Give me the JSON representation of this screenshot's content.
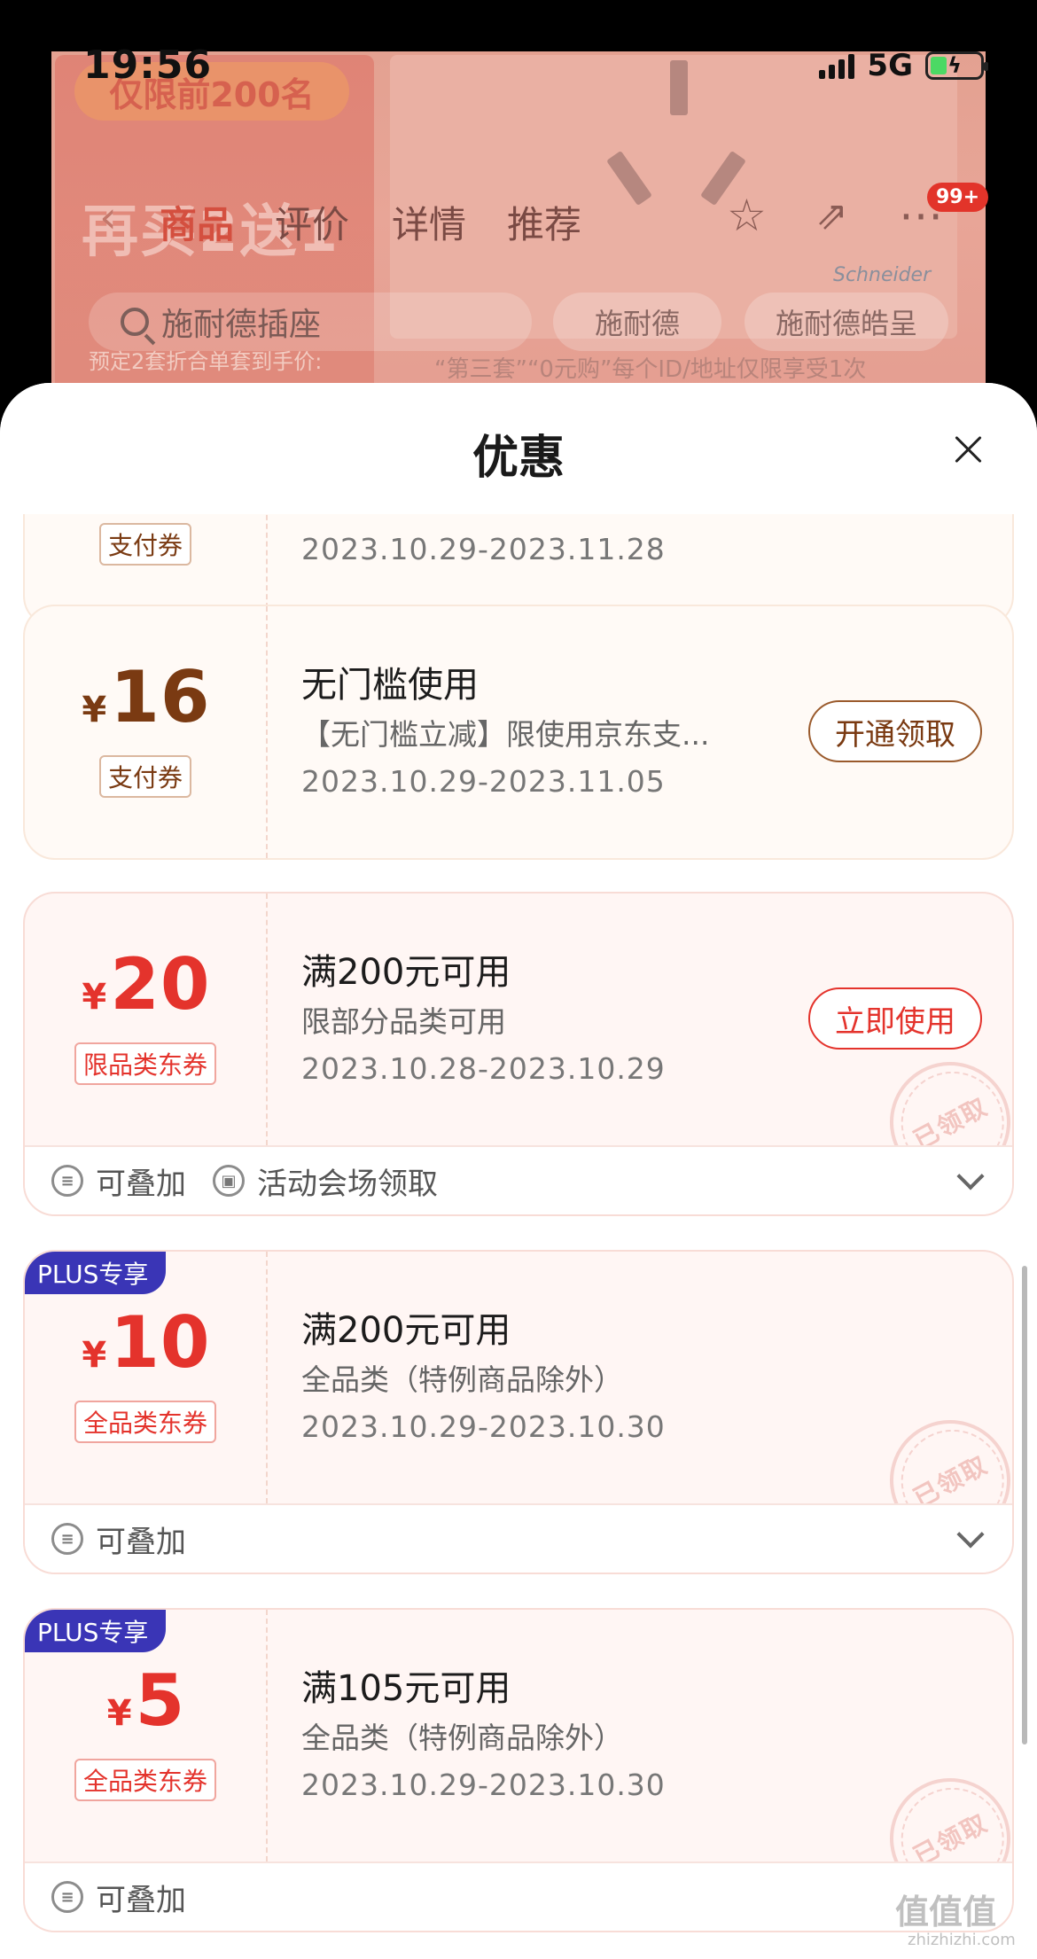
{
  "status_bar": {
    "time": "19:56",
    "network": "5G"
  },
  "background_page": {
    "promo_tag": "仅限前200名",
    "promo_headline": "再买2送1",
    "promo_sub": "预定2套折合单套到手价:",
    "nav_tabs": [
      "商品",
      "评价",
      "详情",
      "推荐"
    ],
    "active_tab": "商品",
    "badge": "99+",
    "search_placeholder": "施耐德插座",
    "chips": [
      "施耐德",
      "施耐德皓呈"
    ],
    "note": "“第三套”“0元购”每个ID/地址仅限享受1次",
    "brand": "Schneider"
  },
  "sheet": {
    "title": "优惠",
    "coupons": [
      {
        "style": "warm",
        "amount": "16",
        "currency": "¥",
        "type": "支付券",
        "title": "无门槛使用",
        "desc": "【无门槛立减】限使用京东支...",
        "date": "2023.10.29-2023.11.05",
        "button": "开通领取"
      },
      {
        "style": "red",
        "amount": "20",
        "currency": "¥",
        "type": "限品类东券",
        "title": "满200元可用",
        "desc": "限部分品类可用",
        "date": "2023.10.28-2023.10.29",
        "button": "立即使用",
        "stamp": "已领取",
        "footer": [
          "可叠加",
          "活动会场领取"
        ]
      },
      {
        "style": "red",
        "badge": "PLUS专享",
        "amount": "10",
        "currency": "¥",
        "type": "全品类东券",
        "title": "满200元可用",
        "desc": "全品类（特例商品除外）",
        "date": "2023.10.29-2023.10.30",
        "stamp": "已领取",
        "footer": [
          "可叠加"
        ]
      },
      {
        "style": "red",
        "badge": "PLUS专享",
        "amount": "5",
        "currency": "¥",
        "type": "全品类东券",
        "title": "满105元可用",
        "desc": "全品类（特例商品除外）",
        "date": "2023.10.29-2023.10.30",
        "stamp": "已领取",
        "footer": [
          "可叠加"
        ]
      }
    ],
    "partial_coupon": {
      "type": "支付券",
      "date": "2023.10.29-2023.11.28"
    }
  },
  "watermark": {
    "text": "值值值",
    "sub": "zhizhizhi.com"
  }
}
